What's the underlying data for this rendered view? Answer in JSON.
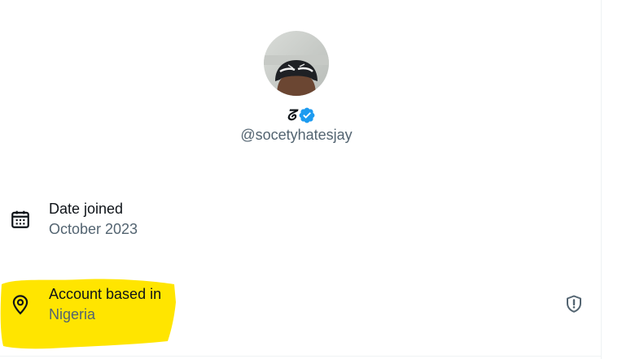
{
  "profile": {
    "display_name": "ᘔ",
    "handle": "@socetyhatesjay"
  },
  "rows": {
    "joined": {
      "title": "Date joined",
      "value": "October 2023",
      "icon": "calendar-icon"
    },
    "location": {
      "title": "Account based in",
      "value": "Nigeria",
      "icon": "location-pin-icon",
      "action_icon": "shield-alert-icon"
    }
  },
  "colors": {
    "primary_text": "#0f1419",
    "secondary_text": "#536471",
    "verified_blue": "#1d9bf0",
    "highlight": "#ffe500"
  }
}
